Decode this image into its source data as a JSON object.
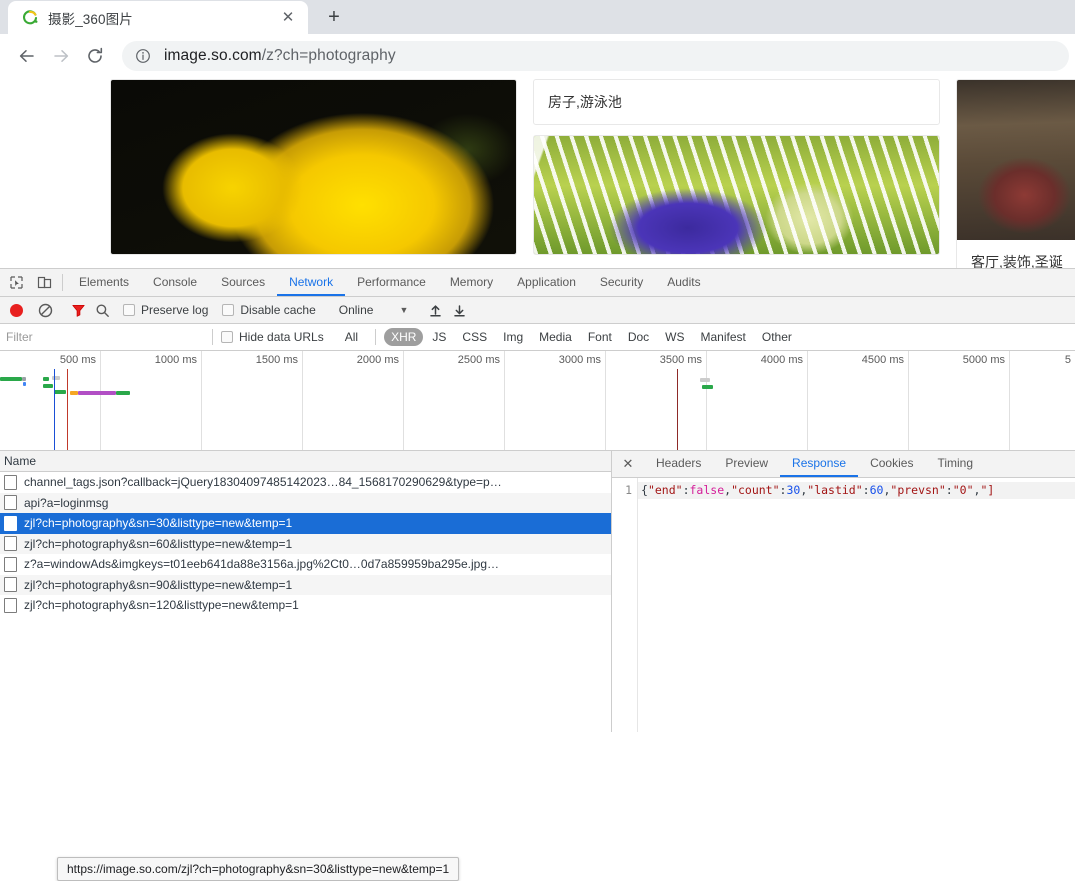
{
  "browser": {
    "tab": {
      "title": "摄影_360图片",
      "favicon": "so-360-logo-icon",
      "close_label": "✕"
    },
    "newtab_label": "+",
    "nav": {
      "back": "back-arrow-icon",
      "forward": "forward-arrow-icon",
      "reload": "reload-icon"
    },
    "omnibox": {
      "security_icon": "info-circle-icon",
      "host": "image.so.com",
      "path": "/z?ch=photography",
      "full_url": "image.so.com/z?ch=photography"
    }
  },
  "page": {
    "cards": [
      {
        "caption": "",
        "kind": "photo-flower"
      },
      {
        "caption": "房子,游泳池",
        "kind": "caption-only"
      },
      {
        "caption": "",
        "kind": "photo-swing"
      },
      {
        "caption": "客厅,装饰,圣诞",
        "kind": "photo-wood"
      }
    ]
  },
  "devtools": {
    "tools": {
      "inspect_icon": "inspect-element-icon",
      "device_icon": "device-toolbar-icon"
    },
    "panels": [
      {
        "label": "Elements",
        "active": false
      },
      {
        "label": "Console",
        "active": false
      },
      {
        "label": "Sources",
        "active": false
      },
      {
        "label": "Network",
        "active": true
      },
      {
        "label": "Performance",
        "active": false
      },
      {
        "label": "Memory",
        "active": false
      },
      {
        "label": "Application",
        "active": false
      },
      {
        "label": "Security",
        "active": false
      },
      {
        "label": "Audits",
        "active": false
      }
    ],
    "controls": {
      "record_icon": "record-button-icon",
      "clear_icon": "clear-icon",
      "filter_icon": "filter-funnel-icon",
      "search_icon": "search-icon",
      "preserve_log": "Preserve log",
      "disable_cache": "Disable cache",
      "throttle_value": "Online",
      "import_icon": "import-har-icon",
      "export_icon": "export-har-icon"
    },
    "filterbar": {
      "filter_placeholder": "Filter",
      "filter_value": "",
      "hide_data_urls": "Hide data URLs",
      "types": [
        {
          "label": "All",
          "active": false
        },
        {
          "label": "XHR",
          "active": true
        },
        {
          "label": "JS",
          "active": false
        },
        {
          "label": "CSS",
          "active": false
        },
        {
          "label": "Img",
          "active": false
        },
        {
          "label": "Media",
          "active": false
        },
        {
          "label": "Font",
          "active": false
        },
        {
          "label": "Doc",
          "active": false
        },
        {
          "label": "WS",
          "active": false
        },
        {
          "label": "Manifest",
          "active": false
        },
        {
          "label": "Other",
          "active": false
        }
      ]
    },
    "overview": {
      "ticks": [
        "500 ms",
        "1000 ms",
        "1500 ms",
        "2000 ms",
        "2500 ms",
        "3000 ms",
        "3500 ms",
        "4000 ms",
        "4500 ms",
        "5000 ms",
        "5"
      ]
    },
    "requests": {
      "column_header": "Name",
      "rows": [
        {
          "name": "channel_tags.json?callback=jQuery18304097485142023…84_1568170290629&type=p…",
          "selected": false
        },
        {
          "name": "api?a=loginmsg",
          "selected": false
        },
        {
          "name": "zjl?ch=photography&sn=30&listtype=new&temp=1",
          "selected": true
        },
        {
          "name": "zjl?ch=photography&sn=60&listtype=new&temp=1",
          "selected": false
        },
        {
          "name": "z?a=windowAds&imgkeys=t01eeb641da88e3156a.jpg%2Ct0…0d7a859959ba295e.jpg…",
          "selected": false
        },
        {
          "name": "zjl?ch=photography&sn=90&listtype=new&temp=1",
          "selected": false
        },
        {
          "name": "zjl?ch=photography&sn=120&listtype=new&temp=1",
          "selected": false
        }
      ],
      "tooltip": "https://image.so.com/zjl?ch=photography&sn=30&listtype=new&temp=1"
    },
    "detail": {
      "close_label": "✕",
      "tabs": [
        {
          "label": "Headers",
          "active": false
        },
        {
          "label": "Preview",
          "active": false
        },
        {
          "label": "Response",
          "active": true
        },
        {
          "label": "Cookies",
          "active": false
        },
        {
          "label": "Timing",
          "active": false
        }
      ],
      "line_number": "1",
      "response_tokens": [
        {
          "t": "{",
          "c": "punc"
        },
        {
          "t": "\"end\"",
          "c": "key"
        },
        {
          "t": ":",
          "c": "punc"
        },
        {
          "t": "false",
          "c": "bool"
        },
        {
          "t": ",",
          "c": "punc"
        },
        {
          "t": "\"count\"",
          "c": "key"
        },
        {
          "t": ":",
          "c": "punc"
        },
        {
          "t": "30",
          "c": "num"
        },
        {
          "t": ",",
          "c": "punc"
        },
        {
          "t": "\"lastid\"",
          "c": "key"
        },
        {
          "t": ":",
          "c": "punc"
        },
        {
          "t": "60",
          "c": "num"
        },
        {
          "t": ",",
          "c": "punc"
        },
        {
          "t": "\"prevsn\"",
          "c": "key"
        },
        {
          "t": ":",
          "c": "punc"
        },
        {
          "t": "\"0\"",
          "c": "str"
        },
        {
          "t": ",",
          "c": "punc"
        },
        {
          "t": "\"]",
          "c": "key"
        }
      ]
    }
  },
  "colors": {
    "accent": "#1a73e8",
    "selection": "#1a6dd6",
    "record": "#e8201f",
    "chrome_tabstrip": "#dee1e6"
  }
}
